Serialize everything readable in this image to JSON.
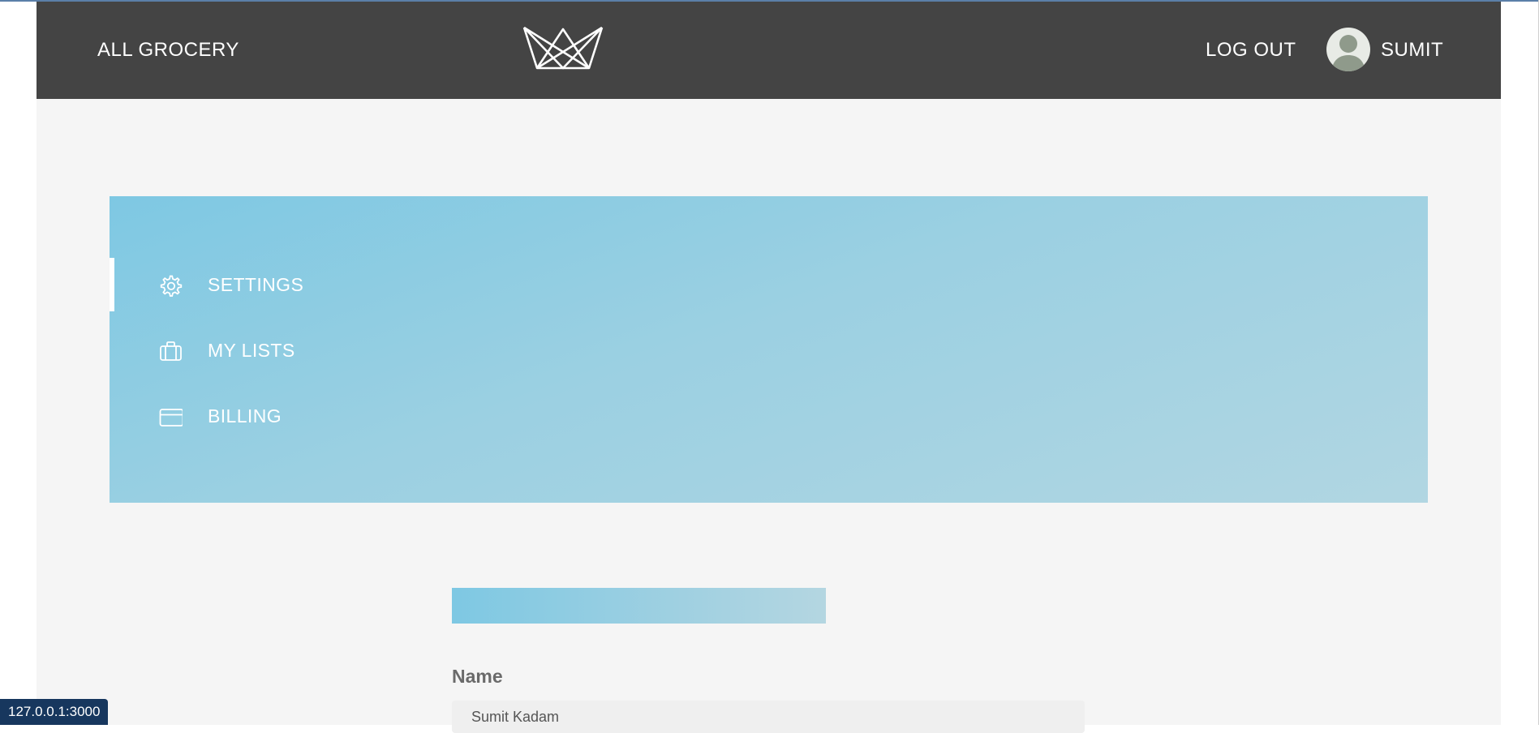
{
  "navbar": {
    "brand_label": "ALL GROCERY",
    "logo_icon": "crown-icon",
    "logout_label": "LOG OUT",
    "username": "SUMIT",
    "avatar_icon": "user-avatar-icon",
    "background_color": "#444444"
  },
  "sidebar": {
    "items": [
      {
        "label": "SETTINGS",
        "icon": "gear-icon",
        "active": true
      },
      {
        "label": "MY LISTS",
        "icon": "briefcase-icon",
        "active": false
      },
      {
        "label": "BILLING",
        "icon": "credit-card-icon",
        "active": false
      }
    ],
    "accent_color": "#7ec8e3"
  },
  "form": {
    "name_label": "Name",
    "name_value": "Sumit Kadam"
  },
  "status_bar": {
    "url": "127.0.0.1:3000"
  }
}
